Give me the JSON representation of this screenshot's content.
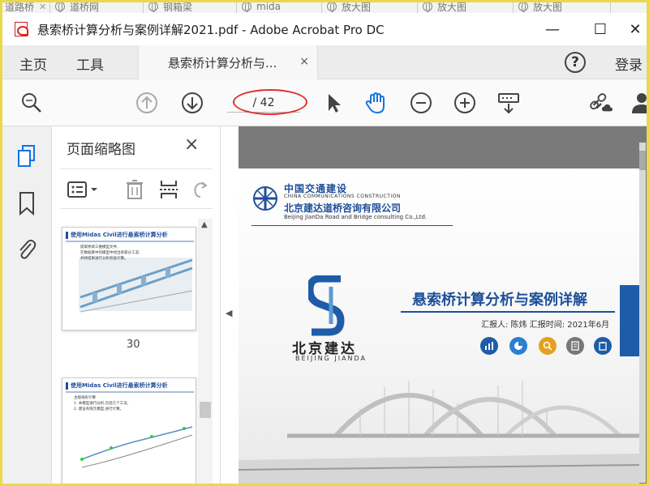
{
  "browser_tabs": [
    {
      "label": "道路桥"
    },
    {
      "label": "道桥网"
    },
    {
      "label": "钢箱梁"
    },
    {
      "label": "mida"
    },
    {
      "label": "放大图"
    },
    {
      "label": "放大图"
    },
    {
      "label": "放大图"
    }
  ],
  "window": {
    "title": "悬索桥计算分析与案例详解2021.pdf - Adobe Acrobat Pro DC",
    "minimize": "—",
    "maximize": "☐",
    "close": "✕"
  },
  "menubar": {
    "home": "主页",
    "tools": "工具",
    "doc_tab": "悬索桥计算分析与...",
    "doc_tab_close": "×",
    "help": "?",
    "login": "登录"
  },
  "toolbar": {
    "page_indicator": "/ 42",
    "icons": [
      "zoom-search-icon",
      "prev-page-icon",
      "next-page-icon",
      "select-cursor-icon",
      "hand-tool-icon",
      "zoom-out-icon",
      "zoom-in-icon",
      "keyboard-scroll-icon",
      "share-link-icon",
      "user-icon"
    ]
  },
  "thumbnail_panel": {
    "title": "页面缩略图",
    "close": "×",
    "thumbs": [
      {
        "page_label": "30",
        "heading": "使用Midas Civil进行悬索桥计算分析",
        "lines": [
          "提取桥梁三维模型文件,",
          "在数据库中的模型中找出各部分工况,",
          "并将结果进行分析校核计算。"
        ]
      },
      {
        "page_label": "",
        "heading": "使用Midas Civil进行悬索桥计算分析",
        "lines": [
          "主缆线形计算",
          "1. 本模型进行分析,包括几个工况,",
          "2. 建设有限元模型,进行计算。"
        ]
      }
    ]
  },
  "document": {
    "company_cn": "中国交通建设",
    "company_en": "CHINA COMMUNICATIONS CONSTRUCTION",
    "subsidiary_cn": "北京建达道桥咨询有限公司",
    "subsidiary_en": "Beijing JianDa Road and Bridge consulting Co.,Ltd.",
    "brand_cn": "北京建达",
    "brand_en": "BEIJING JIANDA",
    "main_title": "悬索桥计算分析与案例详解",
    "reporter_line": "汇报人:  陈炜   汇报时间:  2021年6月",
    "colors": {
      "brand_blue": "#1e4f99",
      "accent": "#1e5ca8"
    }
  },
  "icons": {
    "circle_colors": [
      "#1e5ca8",
      "#2a7fd0",
      "#e4a020",
      "#777777",
      "#1e5ca8"
    ]
  }
}
